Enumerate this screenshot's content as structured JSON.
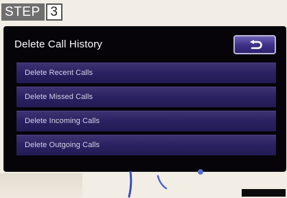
{
  "step": {
    "label": "STEP",
    "number": "3"
  },
  "screen": {
    "title": "Delete Call History",
    "back_icon": "back-arrow-icon",
    "items": [
      {
        "label": "Delete Recent Calls"
      },
      {
        "label": "Delete Missed Calls"
      },
      {
        "label": "Delete Incoming Calls"
      },
      {
        "label": "Delete Outgoing Calls"
      }
    ]
  },
  "colors": {
    "screen_background": "#060409",
    "button_accent": "#3d2f86",
    "page_background": "#f2eee5"
  }
}
